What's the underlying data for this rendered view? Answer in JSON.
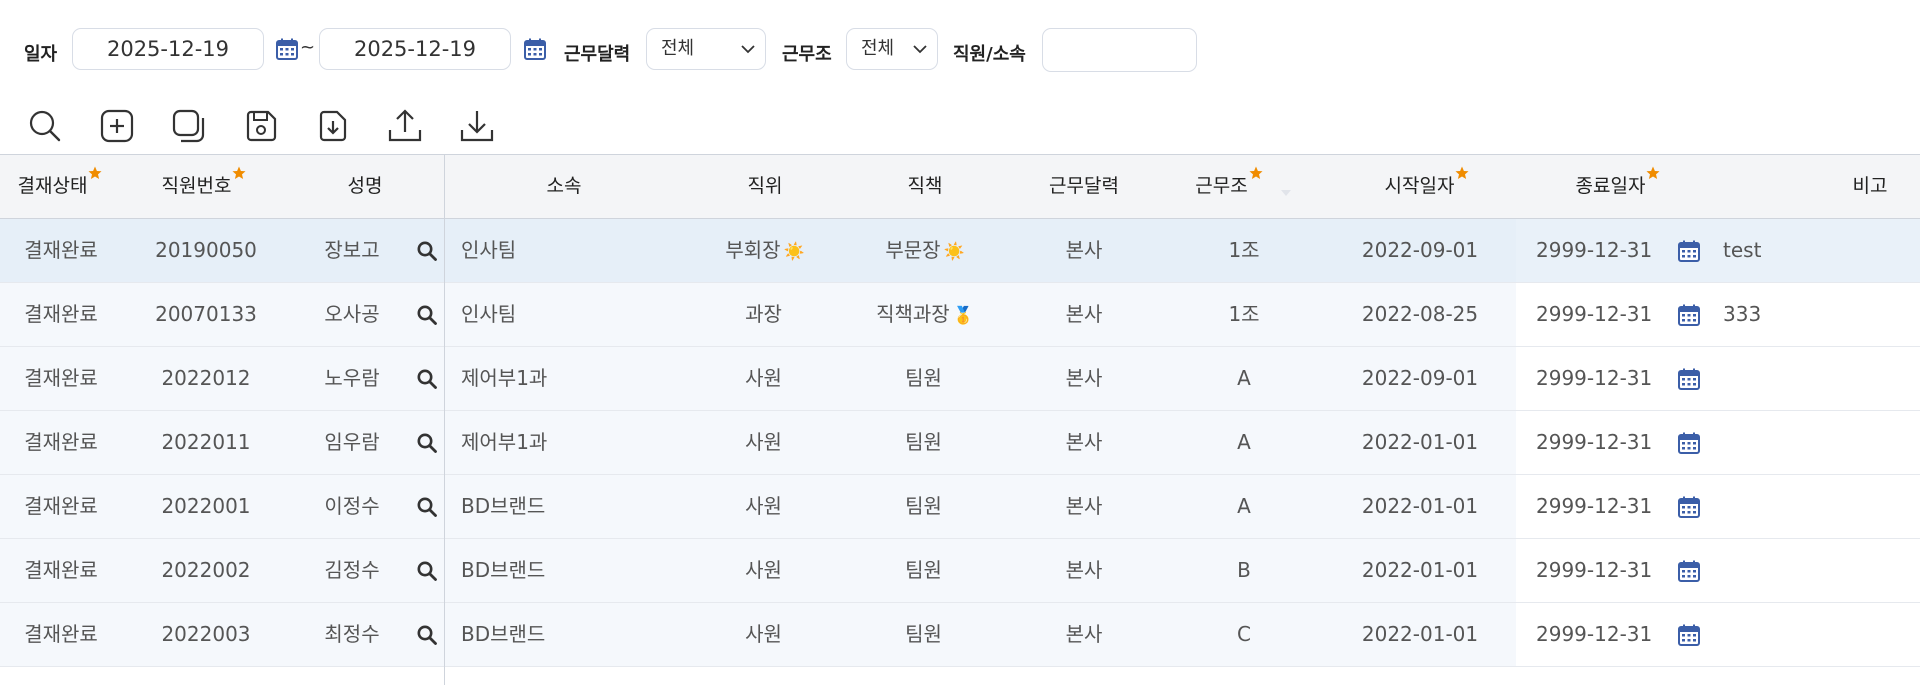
{
  "filters": {
    "date_label": "일자",
    "date_from": "2025-12-19",
    "date_sep": "~",
    "date_to": "2025-12-19",
    "calendar_label": "근무달력",
    "calendar_value": "전체",
    "shift_label": "근무조",
    "shift_value": "전체",
    "employee_label": "직원/소속",
    "employee_value": ""
  },
  "toolbar": {
    "icons": [
      "search-icon",
      "add-icon",
      "copy-icon",
      "save-icon",
      "download-file-icon",
      "upload-icon",
      "download-icon"
    ]
  },
  "colors": {
    "required_star": "#f08c00",
    "calendar_icon": "#3b5ea8",
    "selected_row": "#e6eff8"
  },
  "grid": {
    "headers": {
      "status": "결재상태",
      "emp_no": "직원번호",
      "name": "성명",
      "dept": "소속",
      "position": "직위",
      "duty": "직책",
      "calendar": "근무달력",
      "shift": "근무조",
      "start": "시작일자",
      "end": "종료일자",
      "note": "비고"
    },
    "rows": [
      {
        "status": "결재완료",
        "emp_no": "20190050",
        "name": "장보고",
        "dept": "인사팀",
        "position": "부회장",
        "position_icon": "☀️",
        "duty": "부문장",
        "duty_icon": "☀️",
        "calendar": "본사",
        "shift": "1조",
        "start": "2022-09-01",
        "end": "2999-12-31",
        "note": "test"
      },
      {
        "status": "결재완료",
        "emp_no": "20070133",
        "name": "오사공",
        "dept": "인사팀",
        "position": "과장",
        "position_icon": "",
        "duty": "직책과장",
        "duty_icon": "🥇",
        "calendar": "본사",
        "shift": "1조",
        "start": "2022-08-25",
        "end": "2999-12-31",
        "note": "333"
      },
      {
        "status": "결재완료",
        "emp_no": "2022012",
        "name": "노우람",
        "dept": "제어부1과",
        "position": "사원",
        "position_icon": "",
        "duty": "팀원",
        "duty_icon": "",
        "calendar": "본사",
        "shift": "A",
        "start": "2022-09-01",
        "end": "2999-12-31",
        "note": ""
      },
      {
        "status": "결재완료",
        "emp_no": "2022011",
        "name": "임우람",
        "dept": "제어부1과",
        "position": "사원",
        "position_icon": "",
        "duty": "팀원",
        "duty_icon": "",
        "calendar": "본사",
        "shift": "A",
        "start": "2022-01-01",
        "end": "2999-12-31",
        "note": ""
      },
      {
        "status": "결재완료",
        "emp_no": "2022001",
        "name": "이정수",
        "dept": "BD브랜드",
        "position": "사원",
        "position_icon": "",
        "duty": "팀원",
        "duty_icon": "",
        "calendar": "본사",
        "shift": "A",
        "start": "2022-01-01",
        "end": "2999-12-31",
        "note": ""
      },
      {
        "status": "결재완료",
        "emp_no": "2022002",
        "name": "김정수",
        "dept": "BD브랜드",
        "position": "사원",
        "position_icon": "",
        "duty": "팀원",
        "duty_icon": "",
        "calendar": "본사",
        "shift": "B",
        "start": "2022-01-01",
        "end": "2999-12-31",
        "note": ""
      },
      {
        "status": "결재완료",
        "emp_no": "2022003",
        "name": "최정수",
        "dept": "BD브랜드",
        "position": "사원",
        "position_icon": "",
        "duty": "팀원",
        "duty_icon": "",
        "calendar": "본사",
        "shift": "C",
        "start": "2022-01-01",
        "end": "2999-12-31",
        "note": ""
      }
    ]
  }
}
